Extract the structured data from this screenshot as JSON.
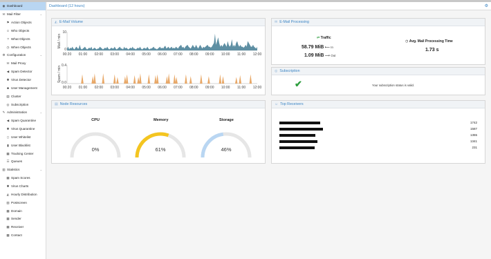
{
  "sidebar": {
    "items": [
      {
        "label": "Dashboard",
        "icon": "dashboard-icon",
        "glyph": "◉",
        "level": 0,
        "active": true
      },
      {
        "label": "Mail Filter",
        "icon": "envelope-icon",
        "glyph": "✉",
        "level": 0,
        "chevron": true
      },
      {
        "label": "Action Objects",
        "icon": "flag-icon",
        "glyph": "⚑",
        "level": 1
      },
      {
        "label": "Who Objects",
        "icon": "user-circle-icon",
        "glyph": "☺",
        "level": 1
      },
      {
        "label": "What Objects",
        "icon": "question-circle-icon",
        "glyph": "?",
        "level": 1
      },
      {
        "label": "When Objects",
        "icon": "clock-icon",
        "glyph": "◷",
        "level": 1
      },
      {
        "label": "Configuration",
        "icon": "cogs-icon",
        "glyph": "⚙",
        "level": 0,
        "chevron": true
      },
      {
        "label": "Mail Proxy",
        "icon": "envelope-o-icon",
        "glyph": "✉",
        "level": 1
      },
      {
        "label": "Spam Detector",
        "icon": "bullhorn-icon",
        "glyph": "◀",
        "level": 1
      },
      {
        "label": "Virus Detector",
        "icon": "bug-icon",
        "glyph": "✱",
        "level": 1
      },
      {
        "label": "User Management",
        "icon": "users-icon",
        "glyph": "☻",
        "level": 1
      },
      {
        "label": "Cluster",
        "icon": "server-icon",
        "glyph": "▤",
        "level": 1
      },
      {
        "label": "Subscription",
        "icon": "support-icon",
        "glyph": "◎",
        "level": 1
      },
      {
        "label": "Administration",
        "icon": "wrench-icon",
        "glyph": "✎",
        "level": 0,
        "chevron": true
      },
      {
        "label": "Spam Quarantine",
        "icon": "bullhorn-icon",
        "glyph": "◀",
        "level": 1
      },
      {
        "label": "Virus Quarantine",
        "icon": "bug-icon",
        "glyph": "✱",
        "level": 1
      },
      {
        "label": "User Whitelist",
        "icon": "file-o-icon",
        "glyph": "▯",
        "level": 1
      },
      {
        "label": "User Blacklist",
        "icon": "file-icon",
        "glyph": "▮",
        "level": 1
      },
      {
        "label": "Tracking Center",
        "icon": "map-o-icon",
        "glyph": "▦",
        "level": 1
      },
      {
        "label": "Queues",
        "icon": "bars-icon",
        "glyph": "☰",
        "level": 1
      },
      {
        "label": "Statistics",
        "icon": "bar-chart-icon",
        "glyph": "▥",
        "level": 0,
        "chevron": true
      },
      {
        "label": "Spam Scores",
        "icon": "table-icon",
        "glyph": "▦",
        "level": 1
      },
      {
        "label": "Virus Charts",
        "icon": "bug-icon",
        "glyph": "✱",
        "level": 1
      },
      {
        "label": "Hourly Distribution",
        "icon": "area-chart-icon",
        "glyph": "◭",
        "level": 1
      },
      {
        "label": "Postscreen",
        "icon": "bar-chart-icon",
        "glyph": "▥",
        "level": 1
      },
      {
        "label": "Domain",
        "icon": "table-icon",
        "glyph": "▦",
        "level": 1
      },
      {
        "label": "Sender",
        "icon": "table-icon",
        "glyph": "▦",
        "level": 1
      },
      {
        "label": "Receiver",
        "icon": "table-icon",
        "glyph": "▦",
        "level": 1
      },
      {
        "label": "Contact",
        "icon": "table-icon",
        "glyph": "▦",
        "level": 1
      }
    ]
  },
  "header": {
    "title": "Dashboard (12 hours)",
    "gear_icon": "gear-icon"
  },
  "email_volume": {
    "title": "E-Mail Volume",
    "mail_ylabel": "Mail / min",
    "spam_ylabel": "Spam / min",
    "mail_ticks": [
      "10",
      "0"
    ],
    "spam_ticks": [
      "0.4",
      "0.0"
    ],
    "xticks": [
      "00:20",
      "01:00",
      "02:00",
      "03:00",
      "04:00",
      "05:00",
      "06:00",
      "07:00",
      "08:00",
      "09:00",
      "10:00",
      "11:00",
      "12:00"
    ]
  },
  "email_processing": {
    "title": "E-Mail Processing",
    "traffic_label": "Traffic",
    "in_value": "58.79 MiB",
    "in_label": "In",
    "out_value": "1.09 MiB",
    "out_label": "Out",
    "avg_label": "Avg. Mail Processing Time",
    "avg_value": "1.73 s"
  },
  "subscription": {
    "title": "Subscription",
    "status_text": "Your subscription status is valid.",
    "status_color": "#2e9e3f"
  },
  "node_resources": {
    "title": "Node Resources",
    "gauges": [
      {
        "label": "CPU",
        "value": "0%",
        "percent": 0,
        "color": "#c8c8c8"
      },
      {
        "label": "Memory",
        "value": "61%",
        "percent": 61,
        "color": "#f4c520"
      },
      {
        "label": "Storage",
        "value": "46%",
        "percent": 46,
        "color": "#b9d6f2"
      }
    ]
  },
  "top_receivers": {
    "title": "Top Receivers",
    "rows": [
      {
        "count": "1742"
      },
      {
        "count": "1587"
      },
      {
        "count": "1355"
      },
      {
        "count": "1341"
      },
      {
        "count": "231"
      }
    ]
  },
  "colors": {
    "accent": "#3a84c4",
    "mail_fill": "#5e8fa3",
    "spam_fill": "#e8a868"
  },
  "chart_data": [
    {
      "type": "area",
      "ylabel": "Mail / min",
      "ylim": [
        0,
        10
      ],
      "xticks": [
        "00:20",
        "01:00",
        "02:00",
        "03:00",
        "04:00",
        "05:00",
        "06:00",
        "07:00",
        "08:00",
        "09:00",
        "10:00",
        "11:00",
        "12:00"
      ],
      "values": [
        1,
        2,
        0.5,
        1.5,
        1,
        2,
        1,
        0.5,
        1.5,
        2,
        1,
        1,
        3,
        1,
        0.5,
        1,
        1.5,
        2,
        1,
        0.5,
        1,
        1.5,
        1,
        2,
        0.5,
        1,
        1.5,
        1,
        0.5,
        1,
        1,
        2,
        1.5,
        1,
        0.5,
        1,
        1.5,
        1,
        2,
        1,
        0.5,
        1,
        1.5,
        1,
        1,
        2,
        1,
        0.5,
        1,
        1.5,
        2,
        1,
        1,
        0.5,
        2,
        1,
        1.5,
        1,
        0.5,
        1,
        1.5,
        1,
        2,
        1,
        1,
        0.5,
        1,
        1.5,
        1,
        2,
        1,
        0.5,
        1,
        1.5,
        1,
        1,
        2,
        1,
        0.5,
        1,
        1,
        1.5,
        2,
        1,
        1,
        0.5,
        1,
        1.5,
        2,
        1,
        1.5,
        1,
        2,
        2.5,
        1,
        1.5,
        2,
        1,
        1.5,
        2,
        1,
        1.5,
        1,
        2,
        1.5,
        1,
        2,
        2.5,
        3,
        1.5,
        2,
        1,
        2,
        2.5,
        3,
        2,
        1.5,
        1,
        2,
        3,
        2,
        1.5,
        3,
        2,
        1,
        2,
        3,
        2,
        1,
        2,
        1.5,
        2,
        2.5,
        3,
        2,
        2,
        1.5,
        2,
        3,
        4,
        9,
        3,
        5,
        7,
        4,
        2,
        3,
        2,
        3,
        4,
        3,
        2,
        5,
        3,
        2,
        3,
        6,
        2,
        3,
        2,
        4,
        5,
        3,
        2,
        3,
        2,
        2,
        1.5,
        2,
        3,
        2,
        5,
        4,
        3,
        2,
        2,
        3,
        2,
        1.5,
        1,
        2
      ]
    },
    {
      "type": "area",
      "ylabel": "Spam / min",
      "ylim": [
        0,
        0.4
      ],
      "xticks": [
        "00:20",
        "01:00",
        "02:00",
        "03:00",
        "04:00",
        "05:00",
        "06:00",
        "07:00",
        "08:00",
        "09:00",
        "10:00",
        "11:00",
        "12:00"
      ],
      "spikes": [
        [
          0.16,
          0.2
        ],
        [
          0.27,
          0.16
        ],
        [
          0.29,
          0.22
        ],
        [
          0.38,
          0.22
        ],
        [
          0.5,
          0.2
        ],
        [
          0.53,
          0.14
        ],
        [
          0.61,
          0.16
        ],
        [
          0.63,
          0.2
        ],
        [
          0.71,
          0.18
        ],
        [
          0.75,
          0.14
        ],
        [
          0.77,
          0.22
        ],
        [
          0.86,
          0.2
        ],
        [
          0.93,
          0.18
        ],
        [
          0.95,
          0.2
        ],
        [
          1.05,
          0.16
        ],
        [
          1.07,
          0.22
        ],
        [
          1.13,
          0.2
        ],
        [
          1.15,
          0.14
        ],
        [
          1.25,
          0.2
        ],
        [
          1.3,
          0.16
        ],
        [
          1.41,
          0.2
        ],
        [
          1.49,
          0.16
        ],
        [
          1.61,
          0.2
        ],
        [
          1.64,
          0.16
        ],
        [
          1.78,
          0.14
        ],
        [
          1.82,
          0.18
        ],
        [
          1.93,
          0.2
        ]
      ]
    }
  ]
}
